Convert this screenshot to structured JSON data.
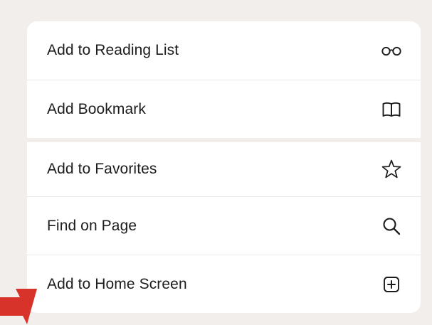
{
  "menu": {
    "items": [
      {
        "label": "Add to Reading List",
        "icon": "reading-glasses-icon"
      },
      {
        "label": "Add Bookmark",
        "icon": "open-book-icon"
      },
      {
        "label": "Add to Favorites",
        "icon": "star-icon"
      },
      {
        "label": "Find on Page",
        "icon": "magnifier-icon"
      },
      {
        "label": "Add to Home Screen",
        "icon": "plus-square-icon"
      }
    ]
  },
  "colors": {
    "background": "#f1eeec",
    "card": "#ffffff",
    "text": "#1c1c1e",
    "arrow": "#d8332b"
  }
}
